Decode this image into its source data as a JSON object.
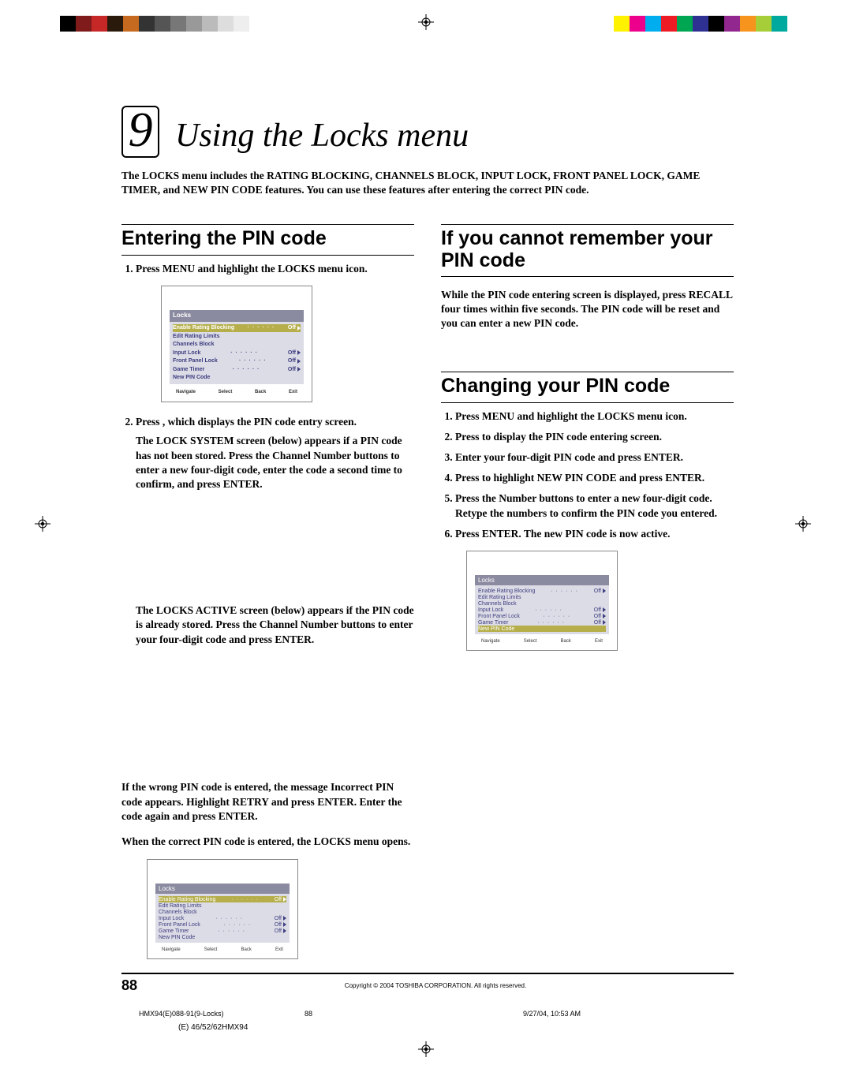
{
  "colorbars": {
    "left": [
      "#000000",
      "#7f1b1b",
      "#c62828",
      "#2a1a0b",
      "#c66a1f",
      "#333333",
      "#555555",
      "#777777",
      "#999999",
      "#bbbbbb",
      "#dddddd",
      "#eeeeee"
    ],
    "right": [
      "#ffffff",
      "#fff200",
      "#ec008c",
      "#00aeef",
      "#ed1c24",
      "#00a651",
      "#2e3192",
      "#000000",
      "#92278f",
      "#f7941d",
      "#a6ce39",
      "#00a99d"
    ]
  },
  "chapter": {
    "number": "9",
    "title": "Using the Locks menu"
  },
  "intro": "The LOCKS menu includes the RATING BLOCKING, CHANNELS BLOCK, INPUT LOCK, FRONT PANEL LOCK, GAME TIMER, and NEW PIN CODE features. You can use these features after entering the correct PIN code.",
  "sections": {
    "entering": {
      "heading": "Entering the PIN code",
      "step1": "Press MENU and highlight the LOCKS menu icon.",
      "step2_a": "Press   , which displays the PIN code entry screen.",
      "step2_b": "The LOCK SYSTEM screen (below) appears if a PIN code has not been stored. Press the Channel Number buttons to enter a new four-digit code, enter the code a second time to confirm, and press ENTER.",
      "step2_c": "The LOCKS ACTIVE screen (below) appears if the PIN code is already stored. Press the Channel Number buttons to enter your four-digit code and press ENTER.",
      "after1": "If the wrong PIN code is entered, the message Incorrect PIN code appears. Highlight RETRY and press ENTER. Enter the code again and press ENTER.",
      "after2": "When the correct PIN code is entered, the LOCKS menu opens."
    },
    "forgot": {
      "heading": "If you cannot remember your PIN code",
      "body": "While the PIN code entering screen is displayed, press RECALL four times within five seconds. The PIN code will be reset and you can enter a new PIN code."
    },
    "changing": {
      "heading": "Changing your PIN code",
      "steps": [
        "Press MENU and highlight the LOCKS menu icon.",
        "Press     to display the PIN code entering screen.",
        "Enter your four-digit PIN code and press ENTER.",
        "Press     to highlight NEW PIN CODE and press ENTER.",
        "Press the Number buttons to enter a new four-digit code. Retype the numbers to confirm the PIN code you entered.",
        "Press ENTER. The new PIN code is now active."
      ]
    }
  },
  "osd": {
    "title": "Locks",
    "rows": [
      {
        "label": "Enable Rating Blocking",
        "value": "Off",
        "arrow": true
      },
      {
        "label": "Edit Rating Limits",
        "value": "",
        "arrow": false
      },
      {
        "label": "Channels Block",
        "value": "",
        "arrow": false
      },
      {
        "label": "Input Lock",
        "value": "Off",
        "arrow": true
      },
      {
        "label": "Front Panel Lock",
        "value": "Off",
        "arrow": true
      },
      {
        "label": "Game Timer",
        "value": "Off",
        "arrow": true
      },
      {
        "label": "New PIN Code",
        "value": "",
        "arrow": false
      }
    ],
    "footer": [
      "Navigate",
      "Select",
      "Back",
      "Exit"
    ],
    "selected_index_screens_1_2": 0,
    "selected_index_screen_3": 6
  },
  "footer": {
    "page": "88",
    "copyright": "Copyright © 2004 TOSHIBA CORPORATION. All rights reserved."
  },
  "slug": {
    "file": "HMX94(E)088-91(9-Locks)",
    "pageno": "88",
    "timestamp": "9/27/04, 10:53 AM",
    "bottom": "(E) 46/52/62HMX94"
  }
}
